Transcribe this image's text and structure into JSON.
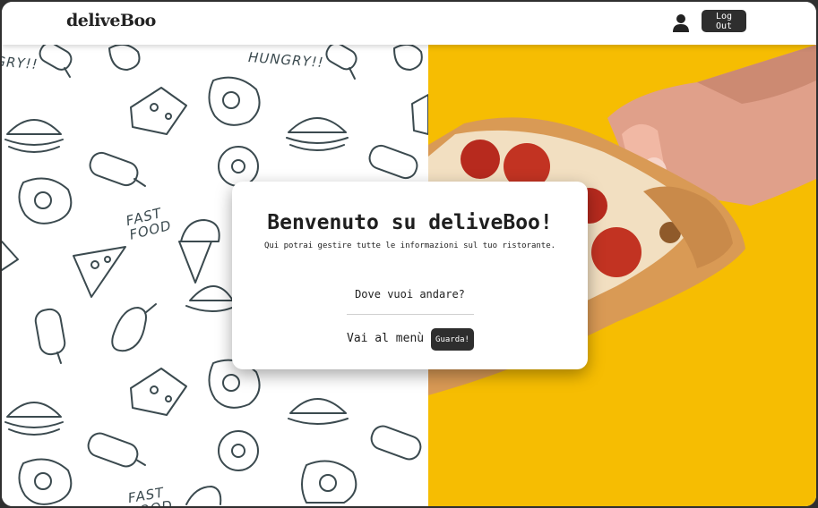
{
  "navbar": {
    "logo": "deliveBoo",
    "user_icon": "user-icon",
    "logout_label": "Log Out"
  },
  "hero": {
    "pattern_texts": [
      "HUNGRY!!",
      "FAST FOOD",
      "HUNGRY!!",
      "FAST FOOD"
    ],
    "background_color": "#f6bd02"
  },
  "welcome_card": {
    "title": "Benvenuto su deliveBoo!",
    "subtitle": "Qui potrai gestire tutte le informazioni sul tuo ristorante.",
    "question": "Dove vuoi andare?",
    "menu_label": "Vai al menù",
    "menu_button_label": "Guarda!"
  },
  "colors": {
    "dark_button": "#2e2e2e",
    "accent_yellow": "#f6bd02",
    "doodle_ink": "#3b4a4f"
  }
}
